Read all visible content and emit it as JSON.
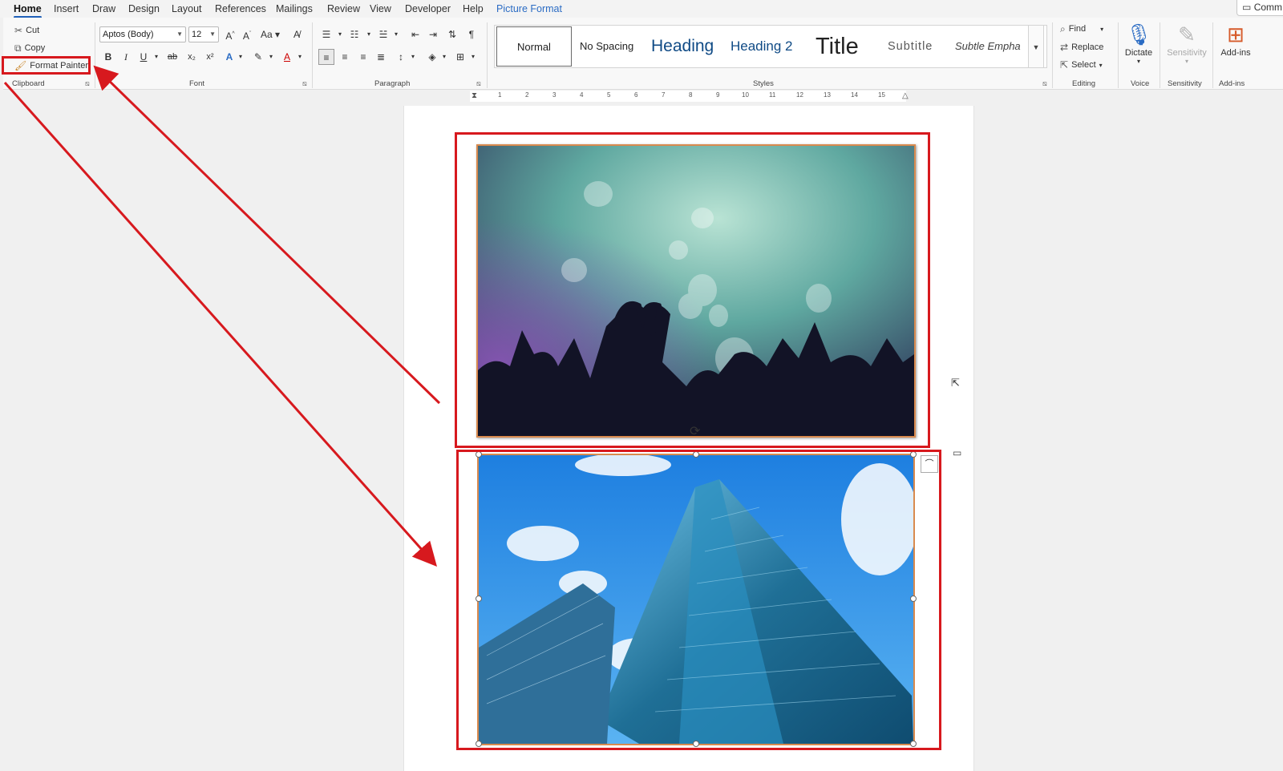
{
  "tabs": [
    {
      "label": "Home",
      "active": true
    },
    {
      "label": "Insert"
    },
    {
      "label": "Draw"
    },
    {
      "label": "Design"
    },
    {
      "label": "Layout"
    },
    {
      "label": "References"
    },
    {
      "label": "Mailings"
    },
    {
      "label": "Review"
    },
    {
      "label": "View"
    },
    {
      "label": "Developer"
    },
    {
      "label": "Help"
    },
    {
      "label": "Picture Format",
      "contextual": true
    }
  ],
  "comments_label": "Comm",
  "clipboard": {
    "cut": "Cut",
    "copy": "Copy",
    "format_painter": "Format Painter",
    "group_label": "Clipboard"
  },
  "font": {
    "family": "Aptos (Body)",
    "size": "12",
    "group_label": "Font"
  },
  "paragraph": {
    "group_label": "Paragraph"
  },
  "styles": {
    "group_label": "Styles",
    "items": [
      "Normal",
      "No Spacing",
      "Heading",
      "Heading 2",
      "Title",
      "Subtitle",
      "Subtle Empha"
    ]
  },
  "editing": {
    "find": "Find",
    "replace": "Replace",
    "select": "Select",
    "group_label": "Editing"
  },
  "voice": {
    "dictate": "Dictate",
    "group_label": "Voice"
  },
  "sensitivity": {
    "button": "Sensitivity",
    "group_label": "Sensitivity"
  },
  "addins": {
    "button": "Add-ins",
    "group_label": "Add-ins"
  },
  "ruler": {
    "labels": [
      "1",
      "2",
      "3",
      "4",
      "5",
      "6",
      "7",
      "8",
      "9",
      "10",
      "11",
      "12",
      "13",
      "14",
      "15"
    ]
  },
  "images": [
    {
      "name": "concert-crowd",
      "description_icon": "crowd-balloons-photo"
    },
    {
      "name": "skyscraper",
      "description_icon": "glass-building-photo"
    }
  ],
  "colors": {
    "annotation_red": "#d7191e",
    "accent_blue": "#1e5fb8",
    "contextual_tab": "#2b6cc4"
  }
}
